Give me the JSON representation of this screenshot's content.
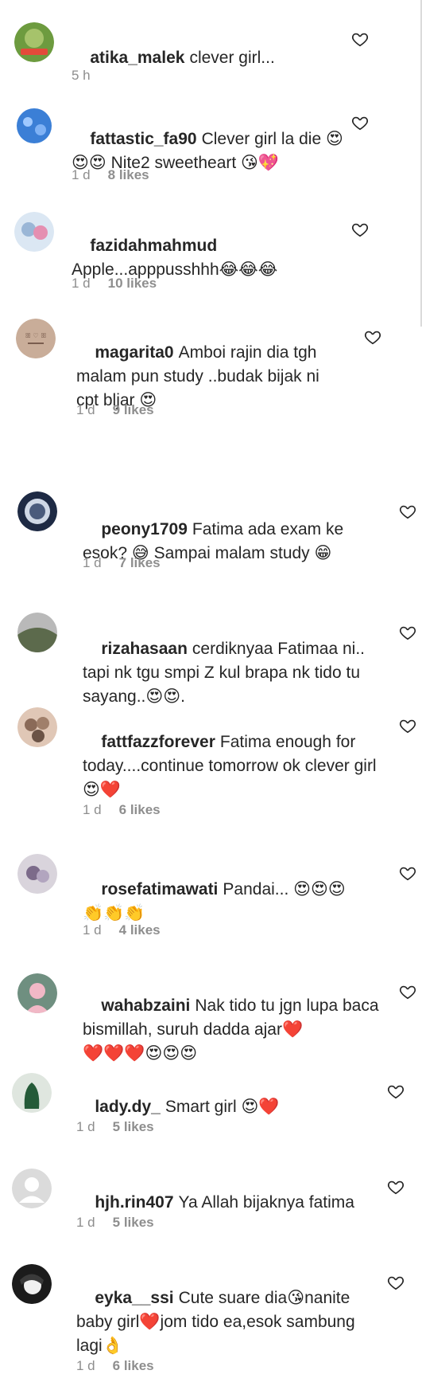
{
  "comments": [
    {
      "username": "atika_malek",
      "text": "clever girl...",
      "time": "5 h",
      "likes": "",
      "avatar_color": "#6d9b3f",
      "avatar_accent": "#e44a3a"
    },
    {
      "username": "fattastic_fa90",
      "text": "Clever girl la die 😍\n😍😍 Nite2 sweetheart 😘💖",
      "time": "1 d",
      "likes": "8 likes",
      "avatar_color": "#3b7fd6",
      "avatar_accent": "#ffffff"
    },
    {
      "username": "fazidahmahmud",
      "text": "\nApple...apppusshhh😂😂😂",
      "time": "1 d",
      "likes": "10 likes",
      "avatar_color": "#9ab6d6",
      "avatar_accent": "#e58fb1"
    },
    {
      "username": "magarita0",
      "text": "Amboi rajin dia tgh malam pun study ..budak bijak ni cpt bljar 😍",
      "time": "1 d",
      "likes": "9 likes",
      "avatar_color": "#c9ad99",
      "avatar_accent": "#7a5d4e"
    },
    {
      "username": "peony1709",
      "text": "Fatima ada exam ke esok? 😅 Sampai malam study 😁",
      "time": "1 d",
      "likes": "7 likes",
      "avatar_color": "#1e2a44",
      "avatar_accent": "#cfd8e6"
    },
    {
      "username": "rizahasaan",
      "text": "cerdiknyaa Fatimaa ni.. tapi nk tgu smpi Z kul brapa nk tido tu sayang..😍😍.",
      "time": "",
      "likes": "",
      "avatar_color": "#5c6a4c",
      "avatar_accent": "#b9b9b9"
    },
    {
      "username": "fattfazzforever",
      "text": "Fatima enough for today....continue tomorrow ok clever girl😍❤️",
      "time": "1 d",
      "likes": "6 likes",
      "avatar_color": "#8a6a58",
      "avatar_accent": "#e0c7b6"
    },
    {
      "username": "rosefatimawati",
      "text": "Pandai... 😍😍😍\n👏👏👏",
      "time": "1 d",
      "likes": "4 likes",
      "avatar_color": "#d9d4dc",
      "avatar_accent": "#7c6b8a"
    },
    {
      "username": "wahabzaini",
      "text": "Nak tido tu jgn lupa baca bismillah, suruh dadda ajar❤️\n❤️❤️❤️😍😍😍",
      "time": "",
      "likes": "",
      "avatar_color": "#6f8f80",
      "avatar_accent": "#f1b8c6"
    },
    {
      "username": "lady.dy_",
      "text": "Smart girl 😍❤️",
      "time": "1 d",
      "likes": "5 likes",
      "avatar_color": "#dfe6df",
      "avatar_accent": "#245a38"
    },
    {
      "username": "hjh.rin407",
      "text": "Ya Allah bijaknya fatima",
      "time": "1 d",
      "likes": "5 likes",
      "avatar_color": "#dbdbdb",
      "avatar_accent": "#ffffff"
    },
    {
      "username": "eyka__ssi",
      "text": "Cute suare dia😘nanite baby girl❤️jom tido ea,esok sambung lagi👌",
      "time": "1 d",
      "likes": "6 likes",
      "avatar_color": "#1b1b1b",
      "avatar_accent": "#f0f0f0"
    }
  ],
  "icons": {
    "like": "heart-outline-icon",
    "avatar_placeholder": "person-silhouette-icon"
  },
  "colors": {
    "text": "#262626",
    "meta": "#8e8e8e",
    "heart_stroke": "#262626"
  }
}
